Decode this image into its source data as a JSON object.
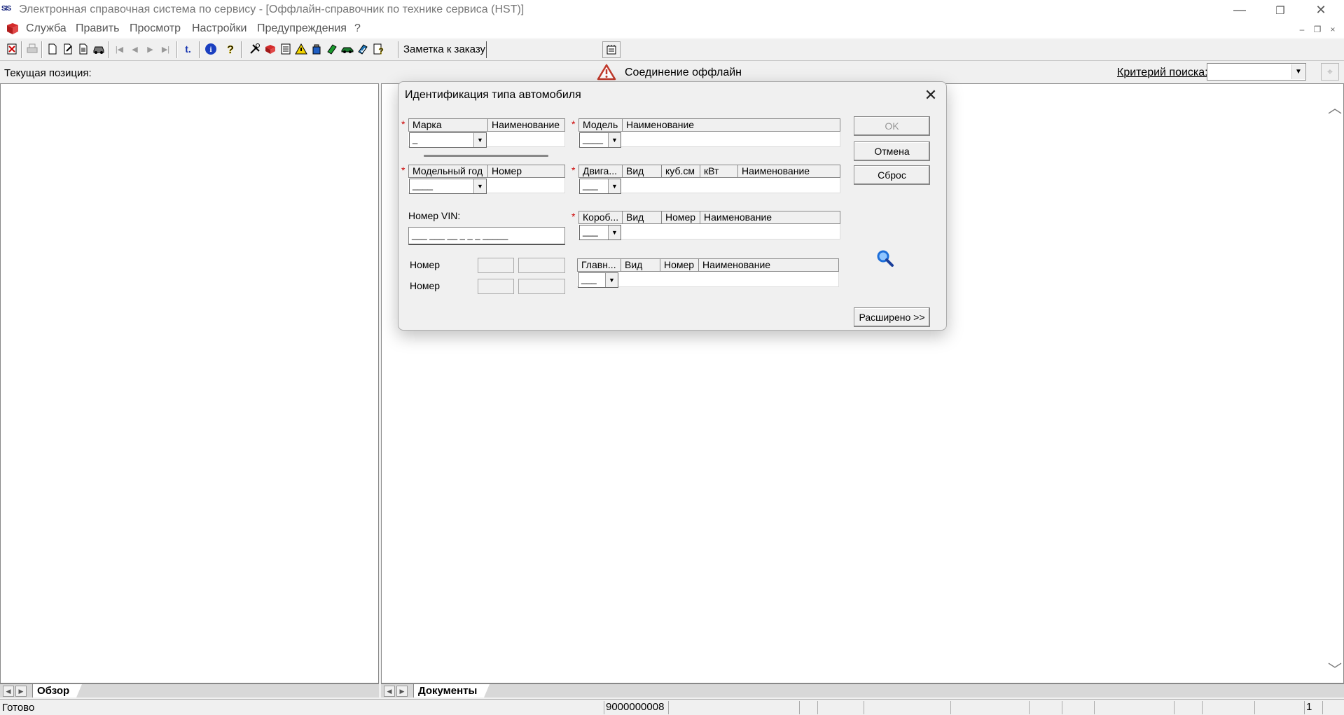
{
  "window": {
    "title": "Электронная справочная система по сервису - [Оффлайн-справочник по технике сервиса (HST)]",
    "app_icon_text": "SIS",
    "minimize": "—",
    "restore": "❐",
    "close": "✕"
  },
  "menu": {
    "items": [
      "Служба",
      "Править",
      "Просмотр",
      "Настройки",
      "Предупреждения",
      "?"
    ],
    "mdi_minimize": "–",
    "mdi_restore": "❐",
    "mdi_close": "×"
  },
  "toolbar": {
    "note_label": "Заметка к заказу:",
    "note_value": ""
  },
  "position_row": {
    "current_position_label": "Текущая позиция:",
    "connection_status": "Соединение оффлайн",
    "search_criterion_label": "Критерий поиска:",
    "search_criterion_value": ""
  },
  "tabs": {
    "left": "Обзор",
    "right": "Документы"
  },
  "statusbar": {
    "ready": "Готово",
    "order_number": "9000000008",
    "page": "1"
  },
  "dialog": {
    "title": "Идентификация типа автомобиля",
    "close": "✕",
    "brand": {
      "headers": [
        "Марка",
        "Наименование"
      ],
      "value": "_"
    },
    "model_year": {
      "headers": [
        "Модельный год",
        "Номер"
      ],
      "value": "____"
    },
    "vin_label": "Номер VIN:",
    "vin_value": "___ ___ __ _ _ _ _____",
    "number_label_1": "Номер",
    "number_label_2": "Номер",
    "model": {
      "headers": [
        "Модель",
        "Наименование"
      ],
      "value": "____"
    },
    "engine": {
      "headers": [
        "Двига...",
        "Вид",
        "куб.см",
        "кВт",
        "Наименование"
      ],
      "value": "___"
    },
    "gearbox": {
      "headers": [
        "Короб...",
        "Вид",
        "Номер",
        "Наименование"
      ],
      "value": "___"
    },
    "main_gear": {
      "headers": [
        "Главн...",
        "Вид",
        "Номер",
        "Наименование"
      ],
      "value": "___"
    },
    "buttons": {
      "ok": "OK",
      "cancel": "Отмена",
      "reset": "Сброс",
      "extended": "Расширено >>"
    }
  },
  "colors": {
    "window_bg": "#f0f0f0",
    "warning_red": "#c0392b",
    "required_star": "#cc0000",
    "search_icon": "#1e6fd9"
  }
}
